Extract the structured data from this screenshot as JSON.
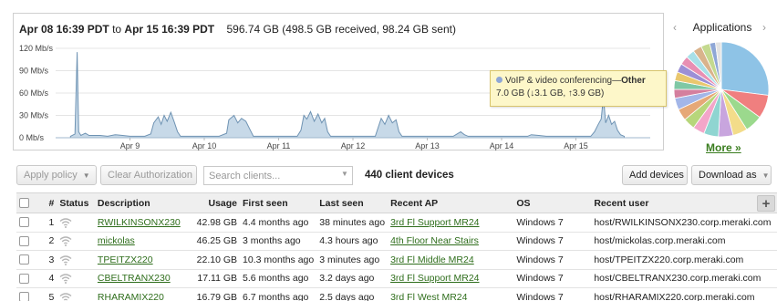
{
  "header": {
    "range_start": "Apr 08 16:39 PDT",
    "range_to": "to",
    "range_end": "Apr 15 16:39 PDT",
    "usage_summary": "596.74 GB (498.5 GB received, 98.24 GB sent)"
  },
  "chart_data": {
    "type": "area",
    "title": "",
    "xlabel": "",
    "ylabel": "",
    "y_ticks": [
      "120 Mb/s",
      "90 Mb/s",
      "60 Mb/s",
      "30 Mb/s",
      "0 Mb/s"
    ],
    "ylim": [
      0,
      120
    ],
    "x_ticks": [
      "Apr 9",
      "Apr 10",
      "Apr 11",
      "Apr 12",
      "Apr 13",
      "Apr 14",
      "Apr 15"
    ],
    "x_range_days": [
      8.0,
      16.0
    ],
    "series": [
      {
        "name": "",
        "points": [
          [
            8.2,
            2
          ],
          [
            8.26,
            5
          ],
          [
            8.29,
            115
          ],
          [
            8.31,
            8
          ],
          [
            8.34,
            3
          ],
          [
            8.4,
            6
          ],
          [
            8.45,
            3
          ],
          [
            8.6,
            3
          ],
          [
            8.7,
            2
          ],
          [
            8.8,
            4
          ],
          [
            8.9,
            3
          ],
          [
            9.0,
            2
          ],
          [
            9.2,
            2
          ],
          [
            9.28,
            5
          ],
          [
            9.32,
            20
          ],
          [
            9.38,
            28
          ],
          [
            9.42,
            18
          ],
          [
            9.46,
            30
          ],
          [
            9.5,
            22
          ],
          [
            9.55,
            34
          ],
          [
            9.6,
            20
          ],
          [
            9.64,
            8
          ],
          [
            9.68,
            2
          ],
          [
            9.9,
            2
          ],
          [
            10.2,
            2
          ],
          [
            10.3,
            6
          ],
          [
            10.33,
            24
          ],
          [
            10.4,
            30
          ],
          [
            10.45,
            20
          ],
          [
            10.5,
            26
          ],
          [
            10.56,
            22
          ],
          [
            10.62,
            10
          ],
          [
            10.66,
            2
          ],
          [
            11.0,
            2
          ],
          [
            11.25,
            2
          ],
          [
            11.3,
            10
          ],
          [
            11.34,
            30
          ],
          [
            11.38,
            25
          ],
          [
            11.43,
            35
          ],
          [
            11.48,
            22
          ],
          [
            11.53,
            32
          ],
          [
            11.58,
            20
          ],
          [
            11.62,
            26
          ],
          [
            11.66,
            8
          ],
          [
            11.7,
            2
          ],
          [
            12.0,
            2
          ],
          [
            12.3,
            2
          ],
          [
            12.34,
            14
          ],
          [
            12.38,
            26
          ],
          [
            12.43,
            18
          ],
          [
            12.48,
            30
          ],
          [
            12.53,
            20
          ],
          [
            12.58,
            24
          ],
          [
            12.62,
            8
          ],
          [
            12.66,
            2
          ],
          [
            13.0,
            2
          ],
          [
            13.35,
            2
          ],
          [
            13.4,
            5
          ],
          [
            13.45,
            8
          ],
          [
            13.5,
            4
          ],
          [
            13.55,
            2
          ],
          [
            14.0,
            2
          ],
          [
            14.35,
            2
          ],
          [
            14.4,
            4
          ],
          [
            14.5,
            3
          ],
          [
            14.6,
            2
          ],
          [
            15.0,
            2
          ],
          [
            15.2,
            2
          ],
          [
            15.25,
            8
          ],
          [
            15.3,
            18
          ],
          [
            15.34,
            25
          ],
          [
            15.37,
            55
          ],
          [
            15.4,
            20
          ],
          [
            15.44,
            30
          ],
          [
            15.48,
            18
          ],
          [
            15.52,
            22
          ],
          [
            15.56,
            10
          ],
          [
            15.6,
            4
          ],
          [
            15.65,
            2
          ]
        ]
      }
    ]
  },
  "tooltip": {
    "category": "VoIP & video conferencing",
    "separator": "—",
    "app": "Other",
    "detail": "7.0 GB (↓3.1 GB, ↑3.9 GB)"
  },
  "applications": {
    "title": "Applications",
    "prev_icon": "‹",
    "next_icon": "›",
    "more_label": "More »",
    "pie_slices": [
      {
        "value": 27,
        "color": "#8ec3e6"
      },
      {
        "value": 8,
        "color": "#f07f7f"
      },
      {
        "value": 6,
        "color": "#9bd98d"
      },
      {
        "value": 5,
        "color": "#f3dc8a"
      },
      {
        "value": 5,
        "color": "#c8a5de"
      },
      {
        "value": 5,
        "color": "#8fd5d1"
      },
      {
        "value": 4,
        "color": "#f3a6c9"
      },
      {
        "value": 4,
        "color": "#b7d67b"
      },
      {
        "value": 4,
        "color": "#e6a877"
      },
      {
        "value": 4,
        "color": "#a3b6e8"
      },
      {
        "value": 3,
        "color": "#d47f9e"
      },
      {
        "value": 3,
        "color": "#7fc8a5"
      },
      {
        "value": 3,
        "color": "#e9c76e"
      },
      {
        "value": 3,
        "color": "#9c8fd6"
      },
      {
        "value": 3,
        "color": "#e88fb3"
      },
      {
        "value": 3,
        "color": "#a8e0e8"
      },
      {
        "value": 3,
        "color": "#d9b38c"
      },
      {
        "value": 3,
        "color": "#c4d98f"
      },
      {
        "value": 2,
        "color": "#8fa7d6"
      },
      {
        "value": 2,
        "color": "#e3e3e3"
      }
    ]
  },
  "toolbar": {
    "apply_policy": "Apply policy",
    "clear_authorization": "Clear Authorization",
    "search_placeholder": "Search clients...",
    "device_count": "440 client devices",
    "add_devices": "Add devices",
    "download_as": "Download as"
  },
  "table": {
    "columns": {
      "num": "#",
      "status": "Status",
      "description": "Description",
      "usage": "Usage",
      "first_seen": "First seen",
      "last_seen": "Last seen",
      "recent_ap": "Recent AP",
      "os": "OS",
      "recent_user": "Recent user",
      "add": "+"
    },
    "rows": [
      {
        "num": "1",
        "description": "RWILKINSONX230",
        "usage": "42.98 GB",
        "first_seen": "4.4 months ago",
        "last_seen": "38 minutes ago",
        "recent_ap": "3rd Fl Support MR24",
        "os": "Windows 7",
        "recent_user": "host/RWILKINSONX230.corp.meraki.com"
      },
      {
        "num": "2",
        "description": "mickolas",
        "usage": "46.25 GB",
        "first_seen": "3 months ago",
        "last_seen": "4.3 hours ago",
        "recent_ap": "4th Floor Near Stairs",
        "os": "Windows 7",
        "recent_user": "host/mickolas.corp.meraki.com"
      },
      {
        "num": "3",
        "description": "TPEITZX220",
        "usage": "22.10 GB",
        "first_seen": "10.3 months ago",
        "last_seen": "3 minutes ago",
        "recent_ap": "3rd Fl Middle MR24",
        "os": "Windows 7",
        "recent_user": "host/TPEITZX220.corp.meraki.com"
      },
      {
        "num": "4",
        "description": "CBELTRANX230",
        "usage": "17.11 GB",
        "first_seen": "5.6 months ago",
        "last_seen": "3.2 days ago",
        "recent_ap": "3rd Fl Support MR24",
        "os": "Windows 7",
        "recent_user": "host/CBELTRANX230.corp.meraki.com"
      },
      {
        "num": "5",
        "description": "RHARAMIX220",
        "usage": "16.79 GB",
        "first_seen": "6.7 months ago",
        "last_seen": "2.5 days ago",
        "recent_ap": "3rd Fl West MR24",
        "os": "Windows 7",
        "recent_user": "host/RHARAMIX220.corp.meraki.com"
      }
    ]
  }
}
